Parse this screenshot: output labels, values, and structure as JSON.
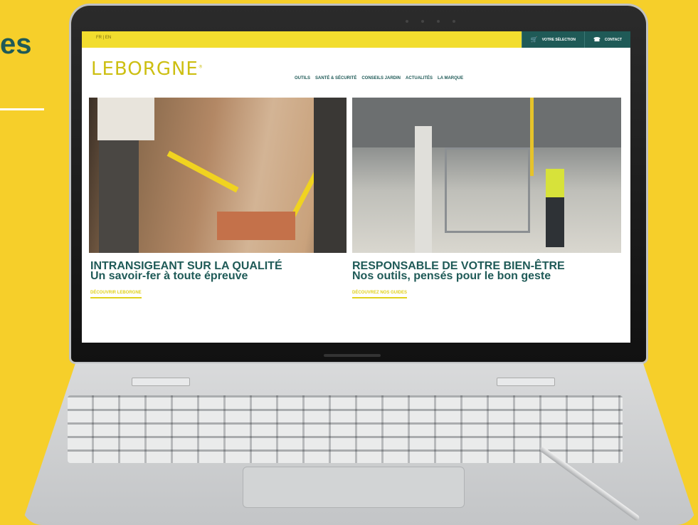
{
  "left_heading": "es",
  "screen": {
    "topbar": {
      "lang": "FR | EN",
      "selection_label": "VOTRE SÉLECTION",
      "contact_label": "CONTACT",
      "selection_icon": "basket-icon",
      "contact_icon": "phone-icon"
    },
    "logo": "LEBORGNE",
    "logo_mark": "®",
    "nav": [
      "OUTILS",
      "SANTÉ & SÉCURITÉ",
      "CONSEILS JARDIN",
      "ACTUALITÉS",
      "LA MARQUE"
    ],
    "cards": [
      {
        "kicker": "INTRANSIGEANT SUR LA QUALITÉ",
        "subtitle": "Un savoir-fer à toute épreuve",
        "cta": "DÉCOUVRIR LEBORGNE"
      },
      {
        "kicker": "RESPONSABLE DE VOTRE BIEN-ÊTRE",
        "subtitle": "Nos outils, pensés pour le bon geste",
        "cta": "DÉCOUVREZ NOS GUIDES"
      }
    ]
  },
  "colors": {
    "background": "#f6cf2a",
    "brand_green": "#1f5a57",
    "brand_yellow": "#e0d11c"
  }
}
